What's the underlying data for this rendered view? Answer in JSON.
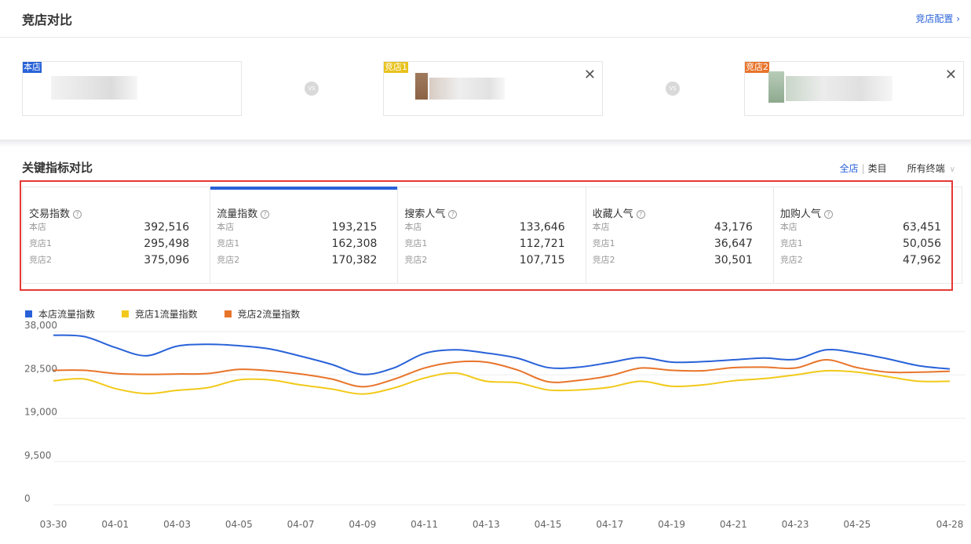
{
  "header": {
    "title": "竞店对比",
    "config_label": "竞店配置 ›"
  },
  "shops": [
    {
      "tag": "本店",
      "tag_color": "#2962d8",
      "closable": false
    },
    {
      "tag": "竞店1",
      "tag_color": "#e8c21c",
      "closable": true
    },
    {
      "tag": "竞店2",
      "tag_color": "#e8742a",
      "closable": true
    }
  ],
  "vs_label": "VS",
  "close_symbol": "✕",
  "section": {
    "title": "关键指标对比",
    "filter_all": "全店",
    "filter_sep": "|",
    "filter_category": "类目",
    "terminal_label": "所有终端",
    "terminal_chevron": "∨"
  },
  "metrics": [
    {
      "name": "交易指数",
      "rows": [
        {
          "label": "本店",
          "value": "392,516"
        },
        {
          "label": "竞店1",
          "value": "295,498"
        },
        {
          "label": "竞店2",
          "value": "375,096"
        }
      ]
    },
    {
      "name": "流量指数",
      "active": true,
      "rows": [
        {
          "label": "本店",
          "value": "193,215"
        },
        {
          "label": "竞店1",
          "value": "162,308"
        },
        {
          "label": "竞店2",
          "value": "170,382"
        }
      ]
    },
    {
      "name": "搜索人气",
      "rows": [
        {
          "label": "本店",
          "value": "133,646"
        },
        {
          "label": "竞店1",
          "value": "112,721"
        },
        {
          "label": "竞店2",
          "value": "107,715"
        }
      ]
    },
    {
      "name": "收藏人气",
      "rows": [
        {
          "label": "本店",
          "value": "43,176"
        },
        {
          "label": "竞店1",
          "value": "36,647"
        },
        {
          "label": "竞店2",
          "value": "30,501"
        }
      ]
    },
    {
      "name": "加购人气",
      "rows": [
        {
          "label": "本店",
          "value": "63,451"
        },
        {
          "label": "竞店1",
          "value": "50,056"
        },
        {
          "label": "竞店2",
          "value": "47,962"
        }
      ]
    }
  ],
  "help_symbol": "?",
  "chart_data": {
    "type": "line",
    "x": [
      "03-30",
      "03-31",
      "04-01",
      "04-02",
      "04-03",
      "04-04",
      "04-05",
      "04-06",
      "04-07",
      "04-08",
      "04-09",
      "04-10",
      "04-11",
      "04-12",
      "04-13",
      "04-14",
      "04-15",
      "04-16",
      "04-17",
      "04-18",
      "04-19",
      "04-20",
      "04-21",
      "04-22",
      "04-23",
      "04-24",
      "04-25",
      "04-26",
      "04-27",
      "04-28"
    ],
    "x_tick_labels": [
      "03-30",
      "04-01",
      "04-03",
      "04-05",
      "04-07",
      "04-09",
      "04-11",
      "04-13",
      "04-15",
      "04-17",
      "04-19",
      "04-21",
      "04-23",
      "04-25",
      "04-28"
    ],
    "y_ticks": [
      0,
      9500,
      19000,
      28500,
      38000
    ],
    "y_tick_labels": [
      "0",
      "9,500",
      "19,000",
      "28,500",
      "38,000"
    ],
    "ylim": [
      0,
      38000
    ],
    "grid": true,
    "legend_position": "top-left",
    "series": [
      {
        "name": "本店流量指数",
        "color": "#2962d8",
        "values": [
          37200,
          36900,
          34500,
          32700,
          34800,
          35200,
          34900,
          34200,
          32600,
          30800,
          28600,
          30000,
          33200,
          34000,
          33300,
          32200,
          30100,
          30200,
          31200,
          32300,
          31300,
          31400,
          31800,
          32200,
          31900,
          34000,
          33300,
          32000,
          30500,
          29800
        ]
      },
      {
        "name": "竞店1流量指数",
        "color": "#f2c91a",
        "values": [
          27200,
          27600,
          25500,
          24400,
          25100,
          25700,
          27400,
          27400,
          26300,
          25400,
          24300,
          25600,
          27800,
          28900,
          27100,
          26800,
          25200,
          25200,
          25800,
          27100,
          26000,
          26300,
          27200,
          27700,
          28500,
          29400,
          29100,
          28100,
          27100,
          27100
        ]
      },
      {
        "name": "竞店2流量指数",
        "color": "#e8742a",
        "values": [
          29500,
          29500,
          28800,
          28600,
          28700,
          28800,
          29700,
          29400,
          28700,
          27600,
          25900,
          27500,
          30000,
          31300,
          31300,
          29600,
          27000,
          27300,
          28300,
          30000,
          29500,
          29400,
          30100,
          30200,
          30000,
          31800,
          30100,
          29100,
          29100,
          29300
        ]
      }
    ]
  }
}
